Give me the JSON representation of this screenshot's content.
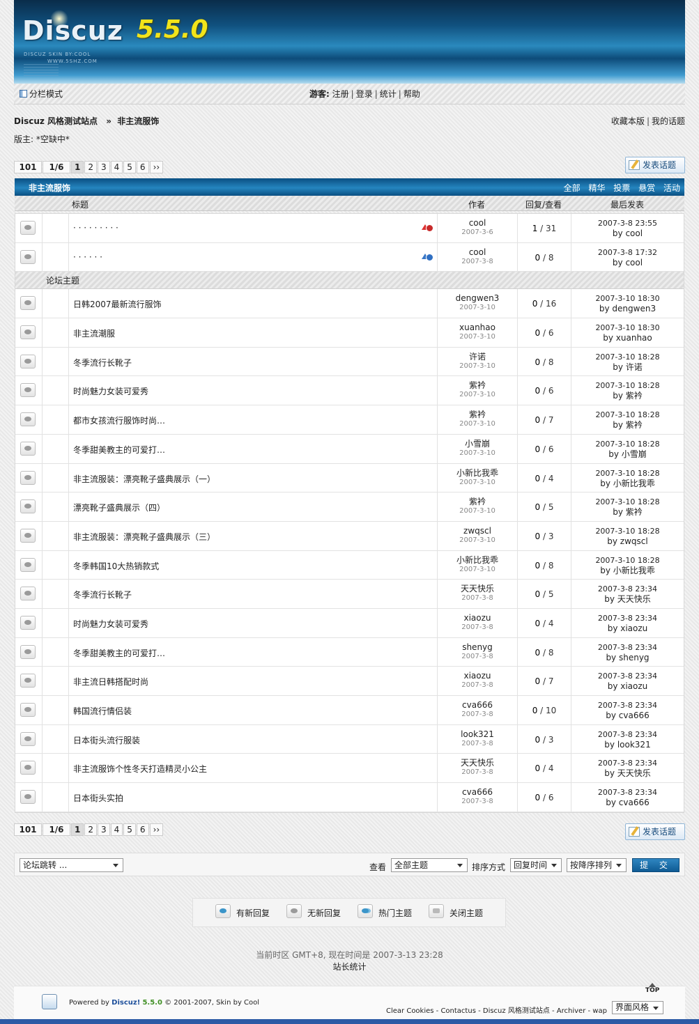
{
  "banner": {
    "logo": "Discuz",
    "version": "5.5.0",
    "skin_line": "DISCUZ SKIN BY:COOL",
    "site_line": "WWW.5SHZ.COM"
  },
  "nav": {
    "mode_label": "分栏模式",
    "guest_label": "游客:",
    "links": [
      "注册",
      "登录",
      "统计",
      "帮助"
    ]
  },
  "breadcrumb": {
    "site": "Discuz 风格测试站点",
    "sep": "»",
    "forum": "非主流服饰"
  },
  "top_links": [
    "收藏本版",
    "我的话题"
  ],
  "moderators": {
    "label": "版主:",
    "value": "*空缺中*"
  },
  "pager": {
    "total": "101",
    "page": "1/6",
    "pages": [
      "1",
      "2",
      "3",
      "4",
      "5",
      "6"
    ],
    "next": "››"
  },
  "post_button": "发表话题",
  "forum_header": {
    "title": "非主流服饰",
    "filters": [
      "全部",
      "精华",
      "投票",
      "悬赏",
      "活动"
    ]
  },
  "columns": {
    "subject": "标题",
    "author": "作者",
    "replies": "回复/查看",
    "last": "最后发表"
  },
  "sticky_topics": [
    {
      "title": "· · · · · · · · ·",
      "author": "cool",
      "date": "2007-3-6",
      "replies": "1",
      "views": "31",
      "last_time": "2007-3-8 23:55",
      "last_by": "by cool",
      "tag": "red"
    },
    {
      "title": "· · · · · ·",
      "author": "cool",
      "date": "2007-3-8",
      "replies": "0",
      "views": "8",
      "last_time": "2007-3-8 17:32",
      "last_by": "by cool",
      "tag": "blue"
    }
  ],
  "section_label": "论坛主题",
  "topics": [
    {
      "title": "日韩2007最新流行服饰",
      "author": "dengwen3",
      "date": "2007-3-10",
      "replies": "0",
      "views": "16",
      "last_time": "2007-3-10 18:30",
      "last_by": "by dengwen3"
    },
    {
      "title": "非主流潮服",
      "author": "xuanhao",
      "date": "2007-3-10",
      "replies": "0",
      "views": "6",
      "last_time": "2007-3-10 18:30",
      "last_by": "by xuanhao"
    },
    {
      "title": "冬季流行长靴子",
      "author": "许诺",
      "date": "2007-3-10",
      "replies": "0",
      "views": "8",
      "last_time": "2007-3-10 18:28",
      "last_by": "by 许诺"
    },
    {
      "title": "时尚魅力女装可爱秀",
      "author": "紫衿",
      "date": "2007-3-10",
      "replies": "0",
      "views": "6",
      "last_time": "2007-3-10 18:28",
      "last_by": "by 紫衿"
    },
    {
      "title": "都市女孩流行服饰时尚…",
      "author": "紫衿",
      "date": "2007-3-10",
      "replies": "0",
      "views": "7",
      "last_time": "2007-3-10 18:28",
      "last_by": "by 紫衿"
    },
    {
      "title": "冬季甜美教主的可爱打…",
      "author": "小雪崩",
      "date": "2007-3-10",
      "replies": "0",
      "views": "6",
      "last_time": "2007-3-10 18:28",
      "last_by": "by 小雪崩"
    },
    {
      "title": "非主流服装：漂亮靴子盛典展示（一）",
      "author": "小新比我乖",
      "date": "2007-3-10",
      "replies": "0",
      "views": "4",
      "last_time": "2007-3-10 18:28",
      "last_by": "by 小新比我乖"
    },
    {
      "title": "漂亮靴子盛典展示（四）",
      "author": "紫衿",
      "date": "2007-3-10",
      "replies": "0",
      "views": "5",
      "last_time": "2007-3-10 18:28",
      "last_by": "by 紫衿"
    },
    {
      "title": "非主流服装：漂亮靴子盛典展示（三）",
      "author": "zwqscl",
      "date": "2007-3-10",
      "replies": "0",
      "views": "3",
      "last_time": "2007-3-10 18:28",
      "last_by": "by zwqscl"
    },
    {
      "title": "冬季韩国10大热销款式",
      "author": "小新比我乖",
      "date": "2007-3-10",
      "replies": "0",
      "views": "8",
      "last_time": "2007-3-10 18:28",
      "last_by": "by 小新比我乖"
    },
    {
      "title": "冬季流行长靴子",
      "author": "天天快乐",
      "date": "2007-3-8",
      "replies": "0",
      "views": "5",
      "last_time": "2007-3-8 23:34",
      "last_by": "by 天天快乐"
    },
    {
      "title": "时尚魅力女装可爱秀",
      "author": "xiaozu",
      "date": "2007-3-8",
      "replies": "0",
      "views": "4",
      "last_time": "2007-3-8 23:34",
      "last_by": "by xiaozu"
    },
    {
      "title": "冬季甜美教主的可爱打…",
      "author": "shenyg",
      "date": "2007-3-8",
      "replies": "0",
      "views": "8",
      "last_time": "2007-3-8 23:34",
      "last_by": "by shenyg"
    },
    {
      "title": "非主流日韩搭配时尚",
      "author": "xiaozu",
      "date": "2007-3-8",
      "replies": "0",
      "views": "7",
      "last_time": "2007-3-8 23:34",
      "last_by": "by xiaozu"
    },
    {
      "title": "韩国流行情侣装",
      "author": "cva666",
      "date": "2007-3-8",
      "replies": "0",
      "views": "10",
      "last_time": "2007-3-8 23:34",
      "last_by": "by cva666"
    },
    {
      "title": "日本街头流行服装",
      "author": "look321",
      "date": "2007-3-8",
      "replies": "0",
      "views": "3",
      "last_time": "2007-3-8 23:34",
      "last_by": "by look321"
    },
    {
      "title": "非主流服饰个性冬天打造精灵小公主",
      "author": "天天快乐",
      "date": "2007-3-8",
      "replies": "0",
      "views": "4",
      "last_time": "2007-3-8 23:34",
      "last_by": "by 天天快乐"
    },
    {
      "title": "日本街头实拍",
      "author": "cva666",
      "date": "2007-3-8",
      "replies": "0",
      "views": "6",
      "last_time": "2007-3-8 23:34",
      "last_by": "by cva666"
    }
  ],
  "bottom_bar": {
    "jump_select": "论坛跳转 ...",
    "view_label": "查看",
    "view_select": "全部主题",
    "sort_label": "排序方式",
    "sort_select": "回复时间",
    "order_select": "按降序排列",
    "submit": "提 交"
  },
  "legend": [
    "有新回复",
    "无新回复",
    "热门主题",
    "关闭主题"
  ],
  "time_info": "当前时区 GMT+8, 现在时间是 2007-3-13 23:28",
  "stats_link": "站长统计",
  "footer": {
    "powered": "Powered by",
    "brand": "Discuz!",
    "version": "5.5.0",
    "copyright": "© 2001-2007, Skin by Cool",
    "links": "Clear Cookies - Contactus - Discuz 风格测试站点 - Archiver - wap",
    "style_select": "界面风格",
    "top": "TOP"
  }
}
